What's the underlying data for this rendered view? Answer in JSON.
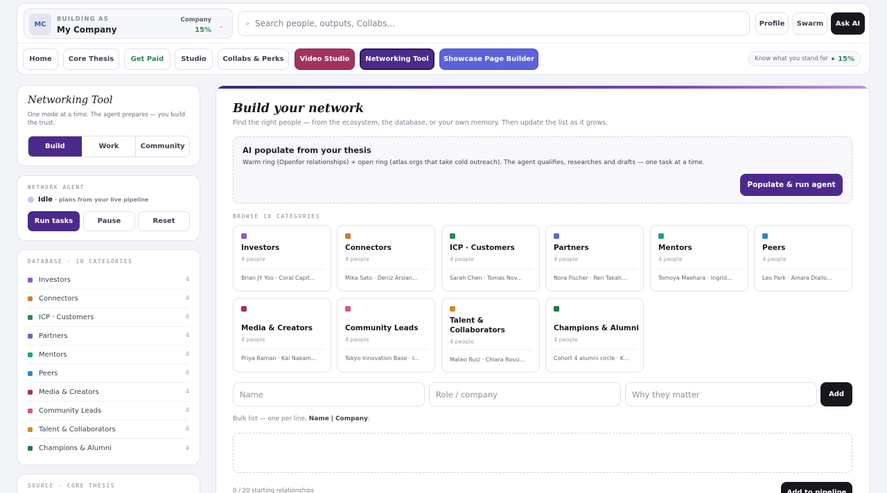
{
  "business": {
    "label": "BUILDING AS",
    "initials": "MC",
    "name": "My Company",
    "company_label": "Company",
    "company_pct": "15%"
  },
  "search": {
    "placeholder": "Search people, outputs, Collabs..."
  },
  "top_buttons": {
    "profile": "Profile",
    "swarm": "Swarm",
    "ask_ai": "Ask AI"
  },
  "nav": [
    "Home",
    "Core Thesis",
    "Get Paid",
    "Studio",
    "Collabs & Perks",
    "Video Studio",
    "Networking Tool",
    "Showcase Page Builder"
  ],
  "stand": {
    "label": "Know what you stand for",
    "value": "15%"
  },
  "tool": {
    "title": "Networking Tool",
    "desc": "One mode at a time. The agent prepares — you build the trust.",
    "modes": [
      "Build",
      "Work",
      "Community"
    ],
    "active_mode": "Build"
  },
  "agent": {
    "heading": "NETWORK AGENT",
    "status": "Idle",
    "status_note": "· plans from your live pipeline",
    "buttons": [
      "Run tasks",
      "Pause",
      "Reset"
    ]
  },
  "database": {
    "heading": "DATABASE · 10 CATEGORIES",
    "items": [
      {
        "name": "Investors",
        "count": "4",
        "color": "#8a5cc7"
      },
      {
        "name": "Connectors",
        "count": "4",
        "color": "#d07a3a"
      },
      {
        "name": "ICP · Customers",
        "count": "4",
        "color": "#2a8a5a"
      },
      {
        "name": "Partners",
        "count": "4",
        "color": "#5a6ad0"
      },
      {
        "name": "Mentors",
        "count": "4",
        "color": "#1fa08a"
      },
      {
        "name": "Peers",
        "count": "4",
        "color": "#2f86c2"
      },
      {
        "name": "Media & Creators",
        "count": "4",
        "color": "#a3325e"
      },
      {
        "name": "Community Leads",
        "count": "4",
        "color": "#d85a7a"
      },
      {
        "name": "Talent & Collaborators",
        "count": "4",
        "color": "#d08a2a"
      },
      {
        "name": "Champions & Alumni",
        "count": "4",
        "color": "#1f7a4a"
      }
    ]
  },
  "source": {
    "heading": "SOURCE · CORE THESIS"
  },
  "main": {
    "title": "Build your network",
    "subtitle": "Find the right people — from the ecosystem, the database, or your own memory. Then update the list as it grows.",
    "ai": {
      "title": "AI populate from your thesis",
      "desc": "Warm ring (Openfor relationships) + open ring (atlas orgs that take cold outreach). The agent qualifies, researches and drafts — one task at a time.",
      "button": "Populate & run agent"
    },
    "browse_heading": "BROWSE 10 CATEGORIES",
    "categories": [
      {
        "name": "Investors",
        "count": "4 people",
        "people": "Brian JY Yoo · Coral Capit...",
        "color": "#8a5cc7"
      },
      {
        "name": "Connectors",
        "count": "4 people",
        "people": "Mika Sato · Deniz Arslan...",
        "color": "#d07a3a"
      },
      {
        "name": "ICP · Customers",
        "count": "4 people",
        "people": "Sarah Chen · Tomas Nov...",
        "color": "#2a8a5a"
      },
      {
        "name": "Partners",
        "count": "4 people",
        "people": "Nora Fischer · Ren Takah...",
        "color": "#5a6ad0"
      },
      {
        "name": "Mentors",
        "count": "4 people",
        "people": "Tomoya Maehara · Ingrid...",
        "color": "#1fa08a"
      },
      {
        "name": "Peers",
        "count": "4 people",
        "people": "Leo Park · Amara Diallo...",
        "color": "#2f86c2"
      },
      {
        "name": "Media & Creators",
        "count": "4 people",
        "people": "Priya Raman · Kai Nakam...",
        "color": "#a3325e"
      },
      {
        "name": "Community Leads",
        "count": "4 people",
        "people": "Tokyo Innovation Base · I...",
        "color": "#d85a7a"
      },
      {
        "name": "Talent & Collaborators",
        "count": "4 people",
        "people": "Mateo Ruiz · Chiara Rossi...",
        "color": "#d08a2a"
      },
      {
        "name": "Champions & Alumni",
        "count": "4 people",
        "people": "Cohort 4 alumni circle · K...",
        "color": "#1f7a4a"
      }
    ],
    "form": {
      "name_ph": "Name",
      "role_ph": "Role / company",
      "why_ph": "Why they matter",
      "add": "Add"
    },
    "bulk": {
      "prefix": "Bulk list — one per line,",
      "field1": "Name",
      "sep": "|",
      "field2": "Company",
      "suffix": ":"
    },
    "count": "0 / 20 starting relationships",
    "pipeline_button": "Add to pipeline"
  }
}
